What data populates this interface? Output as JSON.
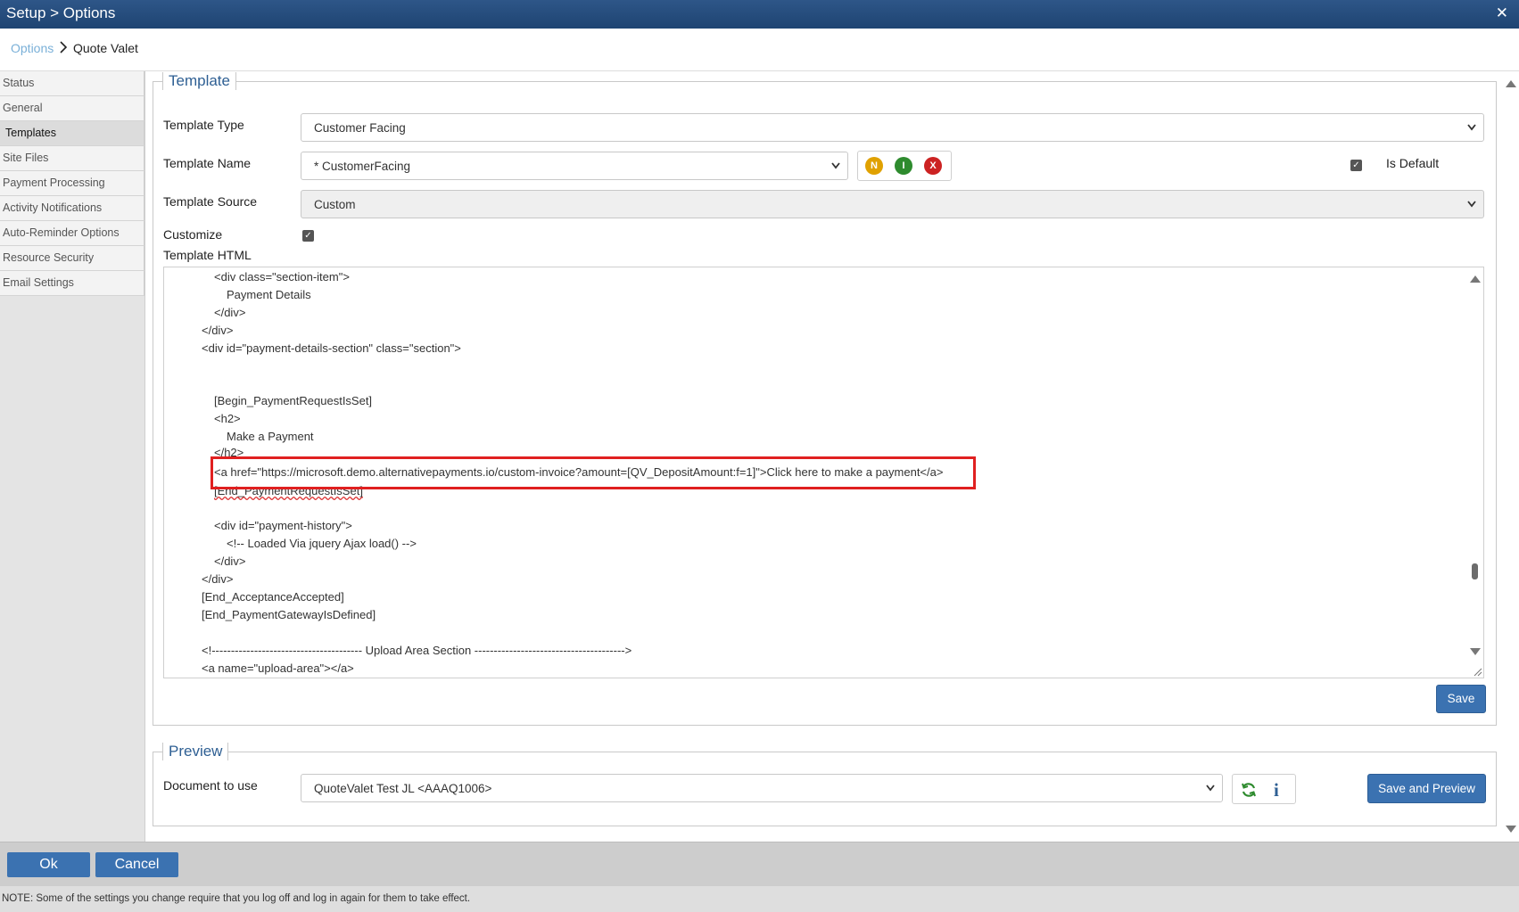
{
  "window": {
    "title": "Setup > Options",
    "close_glyph": "✕"
  },
  "breadcrumb": {
    "link": "Options",
    "current": "Quote Valet"
  },
  "sidebar": {
    "items": [
      {
        "label": "Status"
      },
      {
        "label": "General"
      },
      {
        "label": "Templates",
        "active": true
      },
      {
        "label": "Site Files"
      },
      {
        "label": "Payment Processing"
      },
      {
        "label": "Activity Notifications"
      },
      {
        "label": "Auto-Reminder Options"
      },
      {
        "label": "Resource Security"
      },
      {
        "label": "Email Settings"
      }
    ]
  },
  "template": {
    "legend": "Template",
    "type_label": "Template Type",
    "type_value": "Customer Facing",
    "name_label": "Template Name",
    "name_value": "* CustomerFacing",
    "name_icons": [
      {
        "letter": "N",
        "color": "#e0a100",
        "icon": "new-icon"
      },
      {
        "letter": "I",
        "color": "#2e8b2e",
        "icon": "info-icon"
      },
      {
        "letter": "X",
        "color": "#cc2222",
        "icon": "delete-icon"
      }
    ],
    "is_default_label": "Is Default",
    "source_label": "Template Source",
    "source_value": "Custom",
    "customize_label": "Customize",
    "html_label": "Template HTML",
    "code_lines": [
      "<div class=\"section-item\">",
      "Payment Details",
      "</div>",
      "</div>",
      "<div id=\"payment-details-section\" class=\"section\">",
      "[Begin_PaymentRequestIsSet]",
      "<h2>",
      "Make a Payment",
      "</h2>",
      "<a href=\"https://microsoft.demo.alternativepayments.io/custom-invoice?amount=[QV_DepositAmount:f=1]\">Click here to make a payment</a>",
      "[End_PaymentRequestIsSet]",
      "<div id=\"payment-history\">",
      "<!-- Loaded Via jquery Ajax load() -->",
      "</div>",
      "</div>",
      "[End_AcceptanceAccepted]",
      "[End_PaymentGatewayIsDefined]",
      "<!--------------------------------------- Upload Area Section --------------------------------------->",
      "<a name=\"upload-area\"></a>"
    ],
    "save_label": "Save"
  },
  "preview": {
    "legend": "Preview",
    "doc_label": "Document to use",
    "doc_value": "QuoteValet Test JL <AAAQ1006>",
    "save_preview_label": "Save and Preview"
  },
  "footer": {
    "ok_label": "Ok",
    "cancel_label": "Cancel",
    "note": "NOTE: Some of the settings you change require that you log off and log in again for them to take effect."
  },
  "colors": {
    "titlebar": "#1e4472",
    "accent": "#3b72b1",
    "highlight": "#e02020"
  }
}
